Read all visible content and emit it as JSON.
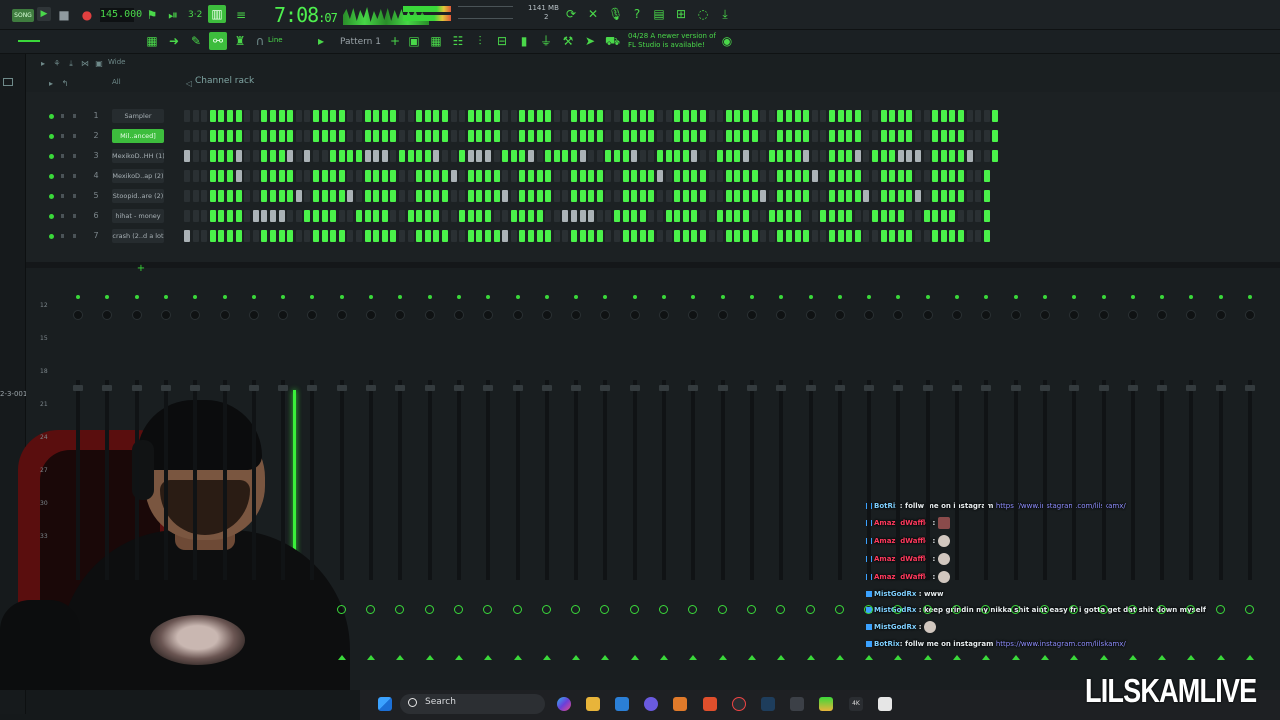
{
  "toolbar": {
    "mode_label": "SONG",
    "tempo": "145.000",
    "time_main": "7:08",
    "time_sub": "07",
    "memory": "1141 MB",
    "memory_sub": "2",
    "pattern": "Pattern 1",
    "snap": "Line",
    "update_hint_line1": "04/28  A newer version of",
    "update_hint_line2": "FL Studio is available!"
  },
  "rack": {
    "header_wide": "Wide",
    "filter": "All",
    "title": "Channel rack",
    "channels": [
      {
        "num": "1",
        "name": "Sampler",
        "selected": false,
        "steps": "...oooo..oooo..oooo..oooo..oooo..oooo..oooo..oooo..oooo..oooo..oooo..oooo..oooo..oooo..oooo...o"
      },
      {
        "num": "2",
        "name": "Mil..anced]",
        "selected": true,
        "steps": "...oooo..oooo..oooo..oooo..oooo..oooo..oooo..oooo..oooo..oooo..oooo..oooo..oooo..oooo..oooo...o"
      },
      {
        "num": "3",
        "name": "MexikoD..HH (1)",
        "selected": false,
        "steps": "m..ooom..ooom.m..oooommm.oooom..ommm.ooom.oooom..ooom..oooom..ooom..oooom..ooom.ooommm.oooom..o"
      },
      {
        "num": "4",
        "name": "MexikoD..ap (2)",
        "selected": false,
        "steps": "...ooom..oooo..oooo..oooo..oooom.oooo..oooo..oooo..oooom.oooo..oooo..oooom.oooo..oooo..oooo..o"
      },
      {
        "num": "5",
        "name": "Stoopid..are (2)",
        "selected": false,
        "steps": "...oooo..oooom.oooom.oooo..oooo..oooom.oooo..oooo..oooo..oooo..oooom.oooo..oooom.oooom.oooo..o"
      },
      {
        "num": "6",
        "name": "hihat - money",
        "selected": false,
        "steps": "...oooo.mmmm..oooo..oooo..oooo..oooo..oooo..mmmm..oooo..oooo..oooo..oooo..oooo..oooo..oooo...o"
      },
      {
        "num": "7",
        "name": "crash (2..d a lot",
        "selected": false,
        "steps": "m..oooo..oooo..oooo..oooo..oooo..oooom.oooo..oooo..oooo..oooo..oooo..oooo..oooo..oooo..oooo..o"
      }
    ]
  },
  "mixer": {
    "timecode": "2-3-001",
    "ruler": [
      "12",
      "15",
      "18",
      "21",
      "24",
      "27",
      "30",
      "33"
    ]
  },
  "chat": {
    "messages": [
      {
        "user": "BotRix",
        "text": ": follw me on instagram ",
        "link": "https://www.instagram.com/lilskamx/",
        "kind": "bot"
      },
      {
        "user": "AmazedWaffle",
        "text": " : ",
        "link": "",
        "kind": "emote"
      },
      {
        "user": "AmazedWaffle",
        "text": " : ",
        "link": "",
        "kind": "emote"
      },
      {
        "user": "AmazedWaffle",
        "text": " : ",
        "link": "",
        "kind": "emote"
      },
      {
        "user": "AmazedWaffle",
        "text": " : ",
        "link": "",
        "kind": "emote"
      },
      {
        "user": "MistGodRx",
        "text": " : www",
        "link": "",
        "kind": "mod"
      },
      {
        "user": "MistGodRx",
        "text": " : keep grindin my nikka shit aint easy fr i gotta get dat shit down myself",
        "link": "",
        "kind": "mod"
      },
      {
        "user": "MistGodRx",
        "text": " : ",
        "link": "",
        "kind": "mod-emote"
      },
      {
        "user": "BotRix",
        "text": ": follw me on instagram ",
        "link": "https://www.instagram.com/lilskamx/",
        "kind": "bot"
      }
    ]
  },
  "taskbar": {
    "search_label": "Search"
  },
  "overlay": {
    "brand": "LILSKAMLIVE"
  }
}
